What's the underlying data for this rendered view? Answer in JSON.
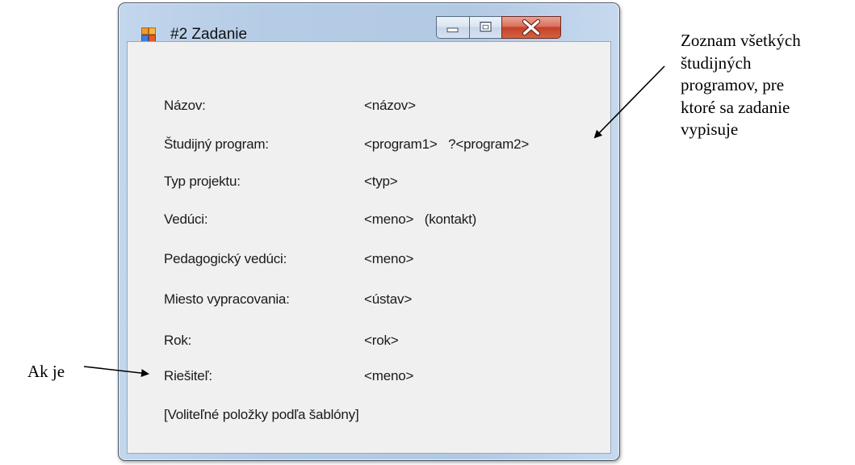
{
  "window": {
    "title": "#2 Zadanie",
    "icon": "windows-form-icon",
    "caption_buttons": [
      "minimize-icon",
      "maximize-icon",
      "close-icon"
    ]
  },
  "form": {
    "fields": [
      {
        "label": "Názov:",
        "value": "<názov>"
      },
      {
        "label": "Študijný program:",
        "value": "<program1>   ?<program2>"
      },
      {
        "label": "Typ projektu:",
        "value": "<typ>"
      },
      {
        "label": "Vedúci:",
        "value": "<meno>   (kontakt)"
      },
      {
        "label": "Pedagogický vedúci:",
        "value": "<meno>"
      },
      {
        "label": "Miesto vypracovania:",
        "value": "<ústav>"
      },
      {
        "label": "Rok:",
        "value": "<rok>"
      },
      {
        "label": "Riešiteľ:",
        "value": "<meno>"
      }
    ],
    "optional_note": "[Voliteľné položky podľa šablóny]"
  },
  "annotations": {
    "right_lines": [
      "Zoznam všetkých",
      "študijných",
      "programov, pre",
      "ktoré sa zadanie",
      "vypisuje"
    ],
    "left": "Ak je"
  },
  "colors": {
    "client_background": "#f0f0f0",
    "frame": "#b5cce6",
    "close_button": "#c94b33"
  }
}
